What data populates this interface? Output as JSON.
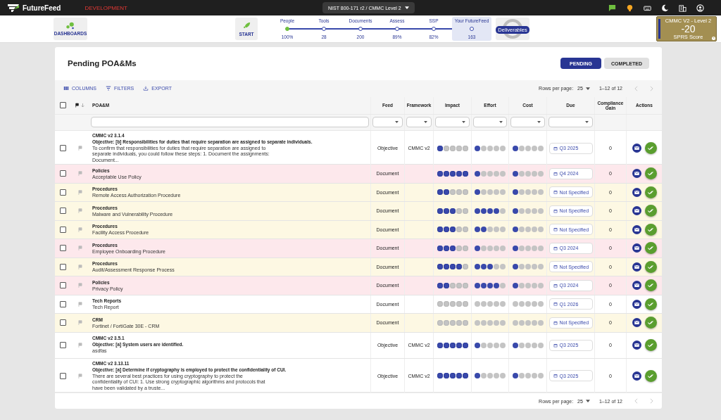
{
  "app": {
    "logo": "FutureFeed",
    "environment": "DEVELOPMENT",
    "framework_selector": "NIST 800-171 r2 / CMMC Level 2"
  },
  "nav": {
    "dashboards": "DASHBOARDS",
    "start": "START",
    "deliverables": "Deliverables",
    "steps": [
      {
        "label": "People",
        "value": "100%",
        "done": true,
        "selected": false
      },
      {
        "label": "Tools",
        "value": "28",
        "done": false,
        "selected": false
      },
      {
        "label": "Documents",
        "value": "200",
        "done": false,
        "selected": false
      },
      {
        "label": "Assess",
        "value": "89%",
        "done": false,
        "selected": false
      },
      {
        "label": "SSP",
        "value": "82%",
        "done": false,
        "selected": false
      },
      {
        "label": "Your FutureFeed",
        "value": "163",
        "done": false,
        "selected": true
      }
    ]
  },
  "score": {
    "title": "CMMC V2 - Level 2",
    "value": "-20",
    "caption": "SPRS Score"
  },
  "page": {
    "title": "Pending POA&Ms",
    "tabs": [
      {
        "label": "PENDING",
        "selected": true
      },
      {
        "label": "COMPLETED",
        "selected": false
      }
    ]
  },
  "toolbar": {
    "columns": "COLUMNS",
    "filters": "FILTERS",
    "export": "EXPORT",
    "rows_per_page_label": "Rows per page:",
    "rows_per_page": "25",
    "range": "1–12 of 12"
  },
  "table": {
    "select_all_checked": false,
    "columns": [
      "POA&M",
      "Feed",
      "Framework",
      "Impact",
      "Effort",
      "Cost",
      "Due",
      "Compliance Gain",
      "Actions"
    ],
    "rows": [
      {
        "kind": "objective",
        "color": "#ffffff",
        "checked": false,
        "heading": "CMMC v2 3.1.4",
        "objective": "Objective: [b] Responsibilities for duties that require separation are assigned to separate individuals.",
        "text": "To confirm that responsibilities for duties that require separation are assigned to separate individuals, you could follow these steps: 1. Document the assignments: Document...",
        "feed": "Objective",
        "framework": "CMMC v2",
        "impact": {
          "stars": 1
        },
        "effort": {
          "stars": 1
        },
        "cost": {
          "stars": 1
        },
        "due": "Q3 2025",
        "gain": "0"
      },
      {
        "kind": "document",
        "color": "#fde8ec",
        "checked": false,
        "heading": "Policies",
        "text": "Acceptable Use Policy",
        "feed": "Document",
        "impact": {
          "stars": 5
        },
        "effort": {
          "stars": 1
        },
        "cost": {
          "stars": 1
        },
        "due": "Q4 2024",
        "gain": "0"
      },
      {
        "kind": "document",
        "color": "#fdf8e3",
        "checked": false,
        "heading": "Procedures",
        "text": "Remote Access Authorization Procedure",
        "feed": "Document",
        "impact": {
          "stars": 2
        },
        "effort": {
          "stars": 1
        },
        "cost": {
          "stars": 1
        },
        "due": "Not Specified",
        "gain": "0"
      },
      {
        "kind": "document",
        "color": "#fdf8e3",
        "checked": false,
        "heading": "Procedures",
        "text": "Malware and Vulnerability Procedure",
        "feed": "Document",
        "impact": {
          "stars": 3
        },
        "effort": {
          "stars": 4
        },
        "cost": {
          "stars": 1
        },
        "due": "Not Specified",
        "gain": "0"
      },
      {
        "kind": "document",
        "color": "#fdf8e3",
        "checked": false,
        "heading": "Procedures",
        "text": "Facility Access Procedure",
        "feed": "Document",
        "impact": {
          "stars": 3
        },
        "effort": {
          "stars": 2
        },
        "cost": {
          "stars": 1
        },
        "due": "Not Specified",
        "gain": "0"
      },
      {
        "kind": "document",
        "color": "#fde8ec",
        "checked": false,
        "heading": "Procedures",
        "text": "Employee Onboarding Procedure",
        "feed": "Document",
        "impact": {
          "stars": 3
        },
        "effort": {
          "stars": 1
        },
        "cost": {
          "stars": 1
        },
        "due": "Q3 2024",
        "gain": "0"
      },
      {
        "kind": "document",
        "color": "#fdf8e3",
        "checked": false,
        "heading": "Procedures",
        "text": "Audit/Assessment Response Process",
        "feed": "Document",
        "impact": {
          "stars": 4
        },
        "effort": {
          "stars": 3
        },
        "cost": {
          "stars": 1
        },
        "due": "Not Specified",
        "gain": "0"
      },
      {
        "kind": "document",
        "color": "#fde8ec",
        "checked": false,
        "heading": "Policies",
        "text": "Privacy Policy",
        "feed": "Document",
        "impact": {
          "stars": 2
        },
        "effort": {
          "stars": 4
        },
        "cost": {
          "stars": 1
        },
        "due": "Q3 2024",
        "gain": "0"
      },
      {
        "kind": "document",
        "color": "#ffffff",
        "checked": false,
        "heading": "Tech Reports",
        "text": "Tech Report",
        "feed": "Document",
        "impact": {
          "stars": 0
        },
        "effort": {
          "stars": 0
        },
        "cost": {
          "stars": 0
        },
        "due": "Q1 2026",
        "gain": "0"
      },
      {
        "kind": "document",
        "color": "#fdf8e3",
        "checked": false,
        "heading": "CRM",
        "text": "Fortinet / FortiGate 30E - CRM",
        "feed": "Document",
        "impact": {
          "stars": 0
        },
        "effort": {
          "stars": 0
        },
        "cost": {
          "stars": 0
        },
        "due": "Not Specified",
        "gain": "0"
      },
      {
        "kind": "objective",
        "color": "#ffffff",
        "checked": false,
        "heading": "CMMC v2 3.5.1",
        "objective": "Objective: [a] System users are identified.",
        "text": "asdfas",
        "feed": "Objective",
        "framework": "CMMC v2",
        "impact": {
          "stars": 5
        },
        "effort": {
          "stars": 1
        },
        "cost": {
          "stars": 1
        },
        "due": "Q3 2025",
        "gain": "0"
      },
      {
        "kind": "objective",
        "color": "#ffffff",
        "checked": false,
        "heading": "CMMC v2 3.13.11",
        "objective": "Objective: [a] Determine if cryptography is employed to protect the confidentiality of CUI.",
        "text": "There are several best practices for using cryptography to protect the confidentiality of CUI: 1. Use strong cryptographic algorithms and protocols that have been validated by a truste...",
        "feed": "Objective",
        "framework": "CMMC v2",
        "impact": {
          "stars": 5
        },
        "effort": {
          "stars": 1
        },
        "cost": {
          "stars": 1
        },
        "due": "Q3 2025",
        "gain": "0"
      }
    ]
  },
  "footer": {
    "rows_per_page_label": "Rows per page:",
    "rows_per_page": "25",
    "range": "1–12 of 12"
  }
}
